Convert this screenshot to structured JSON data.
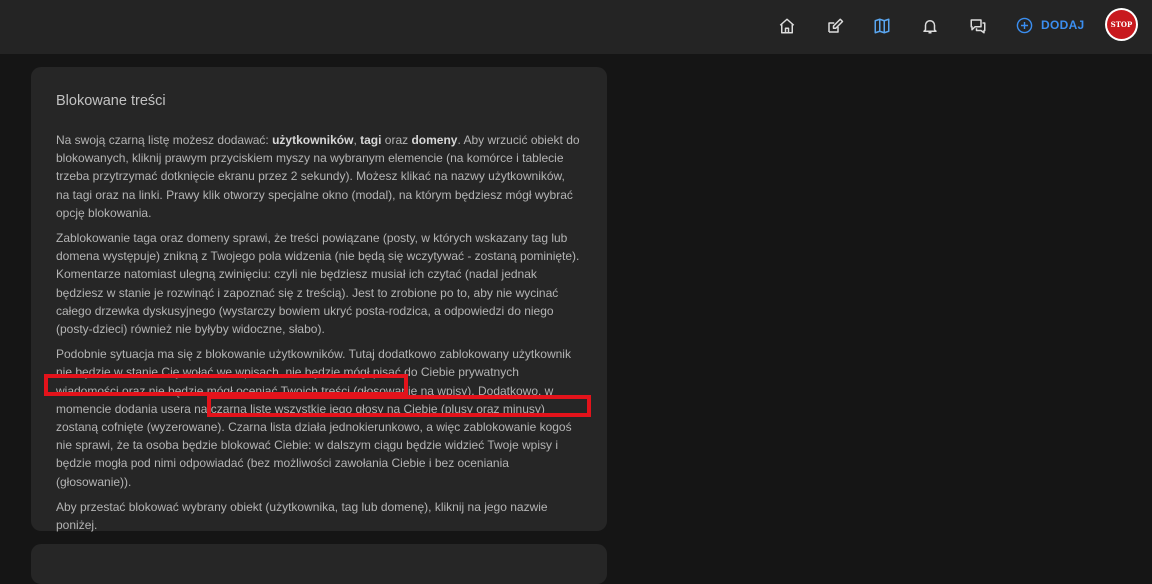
{
  "header": {
    "add_label": "DODAJ",
    "avatar_text": "STOP",
    "icons": [
      "home-icon",
      "edit-icon",
      "map-icon",
      "bell-icon",
      "chat-icon",
      "plus-circle-icon"
    ]
  },
  "card": {
    "title": "Blokowane treści",
    "p1_a": "Na swoją czarną listę możesz dodawać: ",
    "p1_b1": "użytkowników",
    "p1_c": ", ",
    "p1_b2": "tagi",
    "p1_d": " oraz ",
    "p1_b3": "domeny",
    "p1_e": ". Aby wrzucić obiekt do blokowanych, kliknij prawym przyciskiem myszy na wybranym elemencie (na komórce i tablecie trzeba przytrzymać dotknięcie ekranu przez 2 sekundy). Możesz klikać na nazwy użytkowników, na tagi oraz na linki. Prawy klik otworzy specjalne okno (modal), na którym będziesz mógł wybrać opcję blokowania.",
    "p2": "Zablokowanie taga oraz domeny sprawi, że treści powiązane (posty, w których wskazany tag lub domena występuje) znikną z Twojego pola widzenia (nie będą się wczytywać - zostaną pominięte). Komentarze natomiast ulegną zwinięciu: czyli nie będziesz musiał ich czytać (nadal jednak będziesz w stanie je rozwinąć i zapoznać się z treścią). Jest to zrobione po to, aby nie wycinać całego drzewka dyskusyjnego (wystarczy bowiem ukryć posta-rodzica, a odpowiedzi do niego (posty-dzieci) również nie byłyby widoczne, słabo).",
    "p3": "Podobnie sytuacja ma się z blokowanie użytkowników. Tutaj dodatkowo zablokowany użytkownik nie będzie w stanie Cię wołać we wpisach, nie będzie mógł pisać do Ciebie prywatnych wiadomości oraz nie będzie mógł oceniać Twoich treści (głosowanie na wpisy). Dodatkowo, w momencie dodania usera na czarną listę wszystkie jego głosy na Ciebie (plusy oraz minusy) zostaną cofnięte (wyzerowane). Czarna lista działa jednokierunkowo, a więc zablokowanie kogoś nie sprawi, że ta osoba będzie blokować Ciebie: w dalszym ciągu będzie widzieć Twoje wpisy i będzie mogła pod nimi odpowiadać (bez możliwości zawołania Ciebie i bez oceniania (głosowanie)).",
    "p4": "Aby przestać blokować wybrany obiekt (użytkownika, tag lub domenę), kliknij na jego nazwie poniżej."
  },
  "colors": {
    "accent": "#3b8ef0",
    "highlight": "#e3131b",
    "card_bg": "#262626",
    "page_bg": "#151515"
  }
}
